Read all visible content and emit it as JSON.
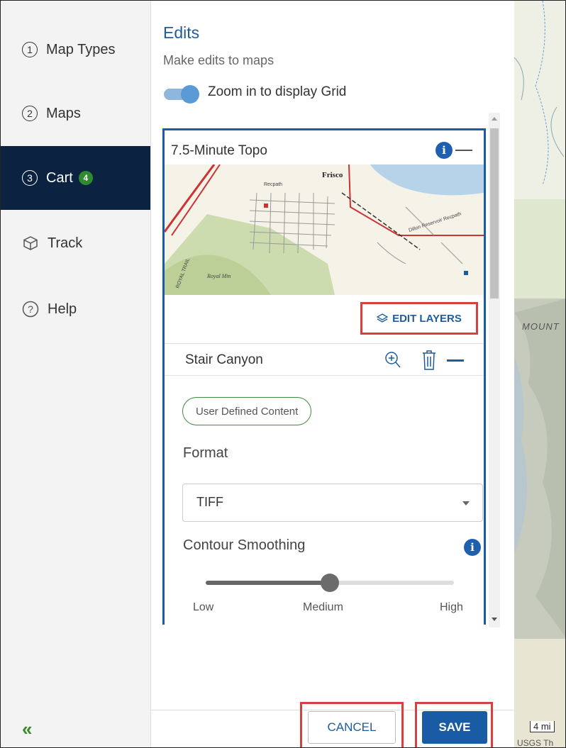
{
  "sidebar": {
    "items": [
      {
        "num": "1",
        "label": "Map Types"
      },
      {
        "num": "2",
        "label": "Maps"
      },
      {
        "num": "3",
        "label": "Cart",
        "badge": "4"
      },
      {
        "label": "Track"
      },
      {
        "label": "Help"
      }
    ],
    "collapse_glyph": "«"
  },
  "panel": {
    "title": "Edits",
    "subtitle": "Make edits to maps",
    "toggle_label": "Zoom in to display Grid",
    "toggle_on": true,
    "card": {
      "title": "7.5-Minute Topo",
      "info_glyph": "i",
      "map_labels": {
        "town": "Frisco",
        "mtn": "Royal Mtn",
        "trail": "ROYAL TRAIL",
        "rec1": "Recpath",
        "rec2": "Dillon Reservoir Recpath"
      },
      "edit_layers_label": "EDIT LAYERS",
      "section_name": "Stair Canyon",
      "pill_label": "User Defined Content",
      "format_label": "Format",
      "format_value": "TIFF",
      "smoothing_label": "Contour Smoothing",
      "smoothing_level": 0.5,
      "smoothing_low": "Low",
      "smoothing_medium": "Medium",
      "smoothing_high": "High"
    }
  },
  "footer": {
    "cancel_label": "CANCEL",
    "save_label": "SAVE"
  },
  "map": {
    "label_mount": "MOUNT",
    "scale_label": "4 mi",
    "attribution": "USGS Th"
  },
  "colors": {
    "nav_active_bg": "#0b2340",
    "accent_blue": "#1a5ba6",
    "badge_green": "#2e8b2e",
    "highlight_red": "#d84040"
  }
}
